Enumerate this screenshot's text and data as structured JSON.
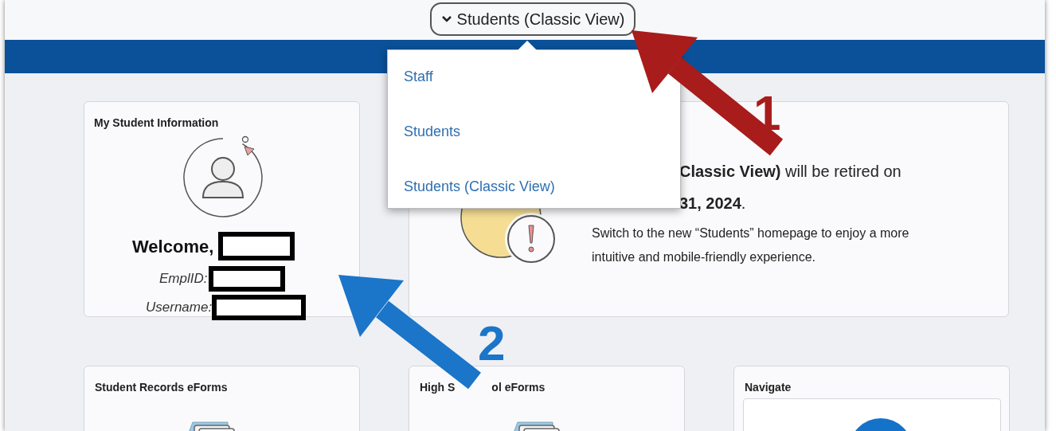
{
  "header": {
    "homepage_selector": "Students (Classic View)"
  },
  "homepage_menu": {
    "items": [
      {
        "label": "Staff"
      },
      {
        "label": "Students"
      },
      {
        "label": "Students (Classic View)"
      }
    ]
  },
  "profile_tile": {
    "title": "My Student Information",
    "welcome": "Welcome,",
    "emplid_label": "EmplID:",
    "username_label": "Username:"
  },
  "notice_tile": {
    "lines": [
      "**Classic View)** will be retired on",
      "**31, 2024**."
    ],
    "message": "Switch to the new “Students” homepage to enjoy a more intuitive and mobile-friendly experience."
  },
  "tiles": [
    {
      "title_parts": [
        "Student Records eForms"
      ],
      "kind": "forms"
    },
    {
      "title_parts": [
        "High S",
        "ol eForms"
      ],
      "kind": "forms"
    },
    {
      "title_parts": [
        "Navigate"
      ],
      "kind": "navigate"
    }
  ],
  "annotations": [
    {
      "label": "1",
      "color": "#a81c1c"
    },
    {
      "label": "2",
      "color": "#1b75c9"
    }
  ]
}
